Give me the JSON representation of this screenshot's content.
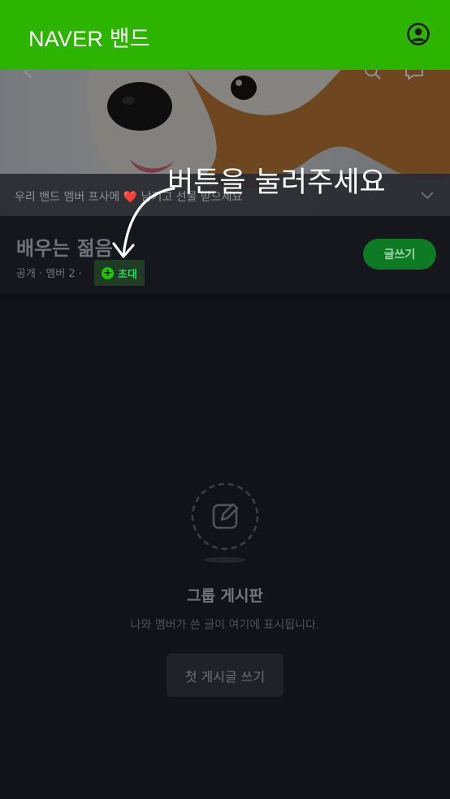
{
  "app": {
    "title": "NAVER 밴드",
    "brand_color": "#2cb400"
  },
  "notice": {
    "text": "우리 밴드 멤버 프사에 ❤️ 남기고 선물 받으세요"
  },
  "band": {
    "name": "배우는 젊음",
    "meta": "공개 · 멤버 2 ·",
    "invite_label": "초대",
    "write_label": "글쓰기"
  },
  "empty_state": {
    "title": "그룹 게시판",
    "description": "나와 멤버가 쓴 글이 여기에 표시됩니다.",
    "button_label": "첫 게시글 쓰기"
  },
  "hint": {
    "text": "버튼을 눌러주세요"
  },
  "icons": [
    "account-icon",
    "back-icon",
    "search-icon",
    "chat-icon",
    "chevron-down-icon",
    "edit-icon",
    "plus-icon",
    "arrow-icon"
  ]
}
